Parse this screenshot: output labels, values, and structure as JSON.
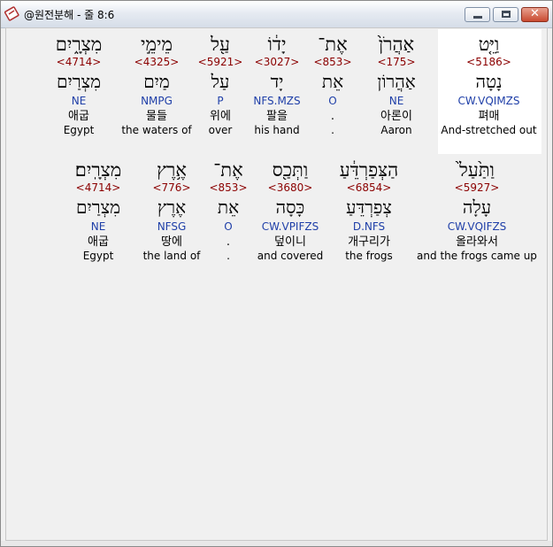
{
  "window": {
    "title": "@원전분해 - 줄 8:6"
  },
  "colors": {
    "strong": "#8b0000",
    "morph": "#1f3fa8",
    "highlight": "#ffffff"
  },
  "icons": {
    "app": "bible-app-icon",
    "minimize": "minimize-icon",
    "maximize": "maximize-icon",
    "close": "close-icon"
  },
  "rows": [
    {
      "words": [
        {
          "hebrew": "מִצְרָ֑יִם",
          "strong": "<4714>",
          "lexeme": "מִצְרַיִם",
          "morph": "NE",
          "korean": "애굽",
          "english": "Egypt"
        },
        {
          "hebrew": "מֵימֵ֣י",
          "strong": "<4325>",
          "lexeme": "מַיִם",
          "morph": "NMPG",
          "korean": "물들",
          "english": "the waters of"
        },
        {
          "hebrew": "עַ֖ל",
          "strong": "<5921>",
          "lexeme": "עַל",
          "morph": "P",
          "korean": "위에",
          "english": "over"
        },
        {
          "hebrew": "יָד֔וֹ",
          "strong": "<3027>",
          "lexeme": "יָד",
          "morph": "NFS.MZS",
          "korean": "팔을",
          "english": "his hand"
        },
        {
          "hebrew": "אֶת־",
          "strong": "<853>",
          "lexeme": "אֵת",
          "morph": "O",
          "korean": ".",
          "english": "."
        },
        {
          "hebrew": "אַהֲרֹן֙",
          "strong": "<175>",
          "lexeme": "אַהֲרוֹן",
          "morph": "NE",
          "korean": "아론이",
          "english": "Aaron"
        },
        {
          "hebrew": "וַיֵּ֤ט",
          "strong": "<5186>",
          "lexeme": "נָטָה",
          "morph": "CW.VQIMZS",
          "korean": "펴매",
          "english": "And-stretched out"
        }
      ]
    },
    {
      "words": [
        {
          "hebrew": "מִצְרָֽיִם׃",
          "strong": "<4714>",
          "lexeme": "מִצְרַיִם",
          "morph": "NE",
          "korean": "애굽",
          "english": "Egypt"
        },
        {
          "hebrew": "אֶ֥רֶץ",
          "strong": "<776>",
          "lexeme": "אֶרֶץ",
          "morph": "NFSG",
          "korean": "땅에",
          "english": "the land of"
        },
        {
          "hebrew": "אֶת־",
          "strong": "<853>",
          "lexeme": "אֵת",
          "morph": "O",
          "korean": ".",
          "english": "."
        },
        {
          "hebrew": "וַתְּכַ֖ס",
          "strong": "<3680>",
          "lexeme": "כָּסָה",
          "morph": "CW.VPIFZS",
          "korean": "덮이니",
          "english": "and covered"
        },
        {
          "hebrew": "הַצְּפַרְדֵּ֔עַ",
          "strong": "<6854>",
          "lexeme": "צְפַרְדֵּעַ",
          "morph": "D.NFS",
          "korean": "개구리가",
          "english": "the frogs"
        },
        {
          "hebrew": "וַתַּ֙עַל֙",
          "strong": "<5927>",
          "lexeme": "עָלָה",
          "morph": "CW.VQIFZS",
          "korean": "올라와서",
          "english": "and the frogs came up"
        }
      ]
    }
  ]
}
